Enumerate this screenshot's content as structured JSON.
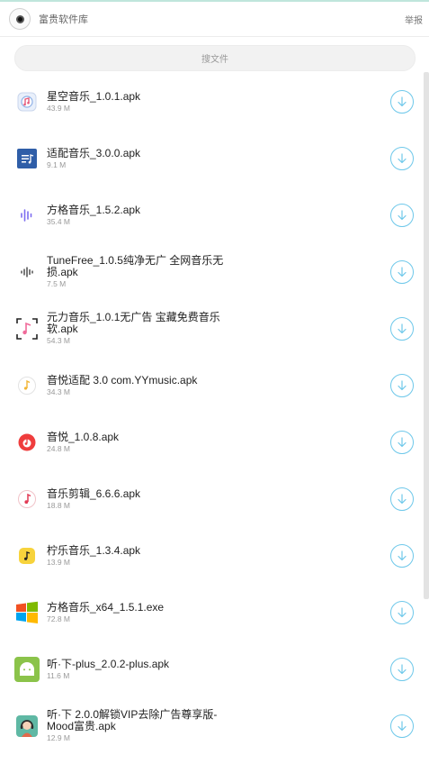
{
  "header": {
    "title": "富贵软件库",
    "report_label": "举报"
  },
  "search": {
    "placeholder": "搜文件"
  },
  "files": [
    {
      "name": "星空音乐_1.0.1.apk",
      "size": "43.9 M",
      "icon": "music-note-icon"
    },
    {
      "name": "适配音乐_3.0.0.apk",
      "size": "9.1 M",
      "icon": "playlist-icon"
    },
    {
      "name": "方格音乐_1.5.2.apk",
      "size": "35.4 M",
      "icon": "sound-wave-icon"
    },
    {
      "name": "TuneFree_1.0.5纯净无广 全网音乐无损.apk",
      "size": "7.5 M",
      "icon": "sound-bars-icon"
    },
    {
      "name": "元力音乐_1.0.1无广告 宝藏免费音乐软.apk",
      "size": "54.3 M",
      "icon": "music-frame-icon"
    },
    {
      "name": "音悦适配 3.0 com.YYmusic.apk",
      "size": "34.3 M",
      "icon": "music-circle-icon"
    },
    {
      "name": "音悦_1.0.8.apk",
      "size": "24.8 M",
      "icon": "red-music-icon"
    },
    {
      "name": "音乐剪辑_6.6.6.apk",
      "size": "18.8 M",
      "icon": "music-edit-icon"
    },
    {
      "name": "柠乐音乐_1.3.4.apk",
      "size": "13.9 M",
      "icon": "lemon-music-icon"
    },
    {
      "name": "方格音乐_x64_1.5.1.exe",
      "size": "72.8 M",
      "icon": "windows-icon"
    },
    {
      "name": "听·下-plus_2.0.2-plus.apk",
      "size": "11.6 M",
      "icon": "android-icon"
    },
    {
      "name": "听·下 2.0.0解锁VIP去除广告尊享版-Mood富贵.apk",
      "size": "12.9 M",
      "icon": "headphone-girl-icon"
    }
  ],
  "colors": {
    "download_accent": "#6ec8ea",
    "header_border": "#bfe6dc"
  }
}
